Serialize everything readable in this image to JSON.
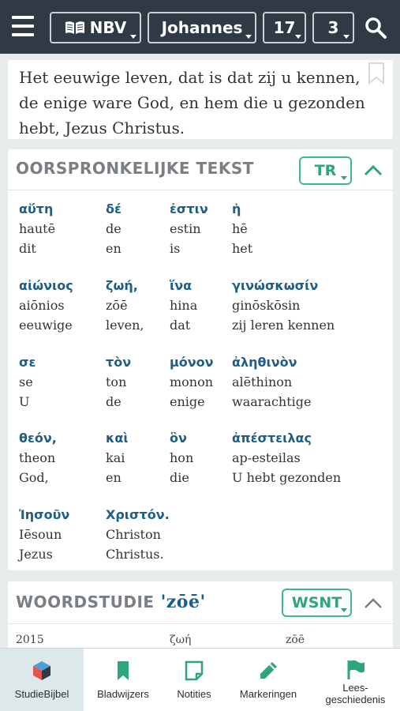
{
  "topbar": {
    "translation": "NBV",
    "book": "Johannes",
    "chapter": "17",
    "verse": "3"
  },
  "verse_text": "Het eeuwige leven, dat is dat zij u kennen, de enige ware God, en hem die u gezonden hebt, Jezus Christus.",
  "original": {
    "title": "OORSPRONKELIJKE TEKST",
    "source_button": "TR",
    "words": [
      {
        "greek": "αὕτη",
        "translit": "hautē",
        "dutch": "dit"
      },
      {
        "greek": "δέ",
        "translit": "de",
        "dutch": "en"
      },
      {
        "greek": "ἐστιν",
        "translit": "estin",
        "dutch": "is"
      },
      {
        "greek": "ἡ",
        "translit": "hē",
        "dutch": "het"
      },
      {
        "greek": "αἰώνιος",
        "translit": "aiōnios",
        "dutch": "eeuwige"
      },
      {
        "greek": "ζωή,",
        "translit": "zōē",
        "dutch": "leven,"
      },
      {
        "greek": "ἵνα",
        "translit": "hina",
        "dutch": "dat"
      },
      {
        "greek": "γινώσκωσίν",
        "translit": "ginōskōsin",
        "dutch": "zij leren kennen"
      },
      {
        "greek": "σε",
        "translit": "se",
        "dutch": "U"
      },
      {
        "greek": "τὸν",
        "translit": "ton",
        "dutch": "de"
      },
      {
        "greek": "μόνον",
        "translit": "monon",
        "dutch": "enige"
      },
      {
        "greek": "ἀληθινὸν",
        "translit": "alēthinon",
        "dutch": "waarachtige"
      },
      {
        "greek": "θεόν,",
        "translit": "theon",
        "dutch": "God,"
      },
      {
        "greek": "καὶ",
        "translit": "kai",
        "dutch": "en"
      },
      {
        "greek": "ὃν",
        "translit": "hon",
        "dutch": "die"
      },
      {
        "greek": "ἀπέστειλας",
        "translit": "ap-esteilas",
        "dutch": "U hebt gezonden"
      },
      {
        "greek": "Ἰησοῦν",
        "translit": "Iēsoun",
        "dutch": "Jezus"
      },
      {
        "greek": "Χριστόν.",
        "translit": "Christon",
        "dutch": "Christus."
      }
    ]
  },
  "study": {
    "title": "WOORDSTUDIE",
    "word": "'zōē'",
    "source_button": "WSNT",
    "row": {
      "number": "2015",
      "greek": "ζωή",
      "translit": "zōē"
    }
  },
  "bottom_nav": [
    {
      "label": "StudieBijbel",
      "icon": "cube-icon",
      "active": true
    },
    {
      "label": "Bladwijzers",
      "icon": "bookmark-icon",
      "active": false
    },
    {
      "label": "Notities",
      "icon": "note-icon",
      "active": false
    },
    {
      "label": "Markeringen",
      "icon": "pencil-icon",
      "active": false
    },
    {
      "label": "Lees-\ngeschiedenis",
      "icon": "flag-icon",
      "active": false
    }
  ],
  "colors": {
    "topbar": "#2f3a45",
    "accent_green": "#2ea57c",
    "greek_blue": "#1e5e86",
    "active_tab_bg": "#dde8ea"
  }
}
